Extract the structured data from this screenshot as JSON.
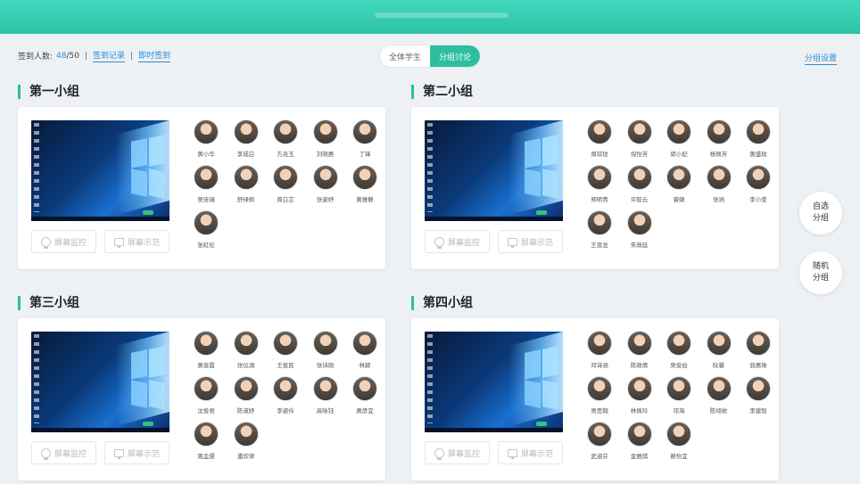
{
  "stats": {
    "label": "签到人数:",
    "checked": "48",
    "total": "/50",
    "separator": "|",
    "record_link": "签到记录",
    "instant_link": "即时签到"
  },
  "view_toggle": {
    "options": [
      "全体学生",
      "分组讨论"
    ],
    "selected": "分组讨论"
  },
  "group_settings": "分组设置",
  "side_buttons": {
    "self_select": "自选\n分组",
    "random": "随机\n分组"
  },
  "card_buttons": {
    "monitor": "屏幕监控",
    "demo": "屏幕示范"
  },
  "groups": [
    {
      "title": "第一小组",
      "members": [
        "黄小华",
        "李成白",
        "方兆玉",
        "刘晓惠",
        "丁锋",
        "吴佳瑞",
        "舒绿佩",
        "周白芷",
        "张姿妤",
        "黄雅静",
        "张虹伦"
      ]
    },
    {
      "title": "第二小组",
      "members": [
        "周琼玟",
        "倪怡芳",
        "郭小妃",
        "杨佩芳",
        "黄盛玫",
        "郑明青",
        "许智云",
        "睿婕",
        "张涵",
        "李小爱",
        "王恩龙",
        "朱政廷"
      ]
    },
    {
      "title": "第三小组",
      "members": [
        "黄竟霞",
        "张仪湖",
        "王俊民",
        "张诗刚",
        "林颖",
        "沈俊君",
        "陈淑妤",
        "李姿伶",
        "高咏钰",
        "黄彦宜",
        "周孟儒",
        "潘欣律"
      ]
    },
    {
      "title": "第四小组",
      "members": [
        "邓诗涵",
        "陈政倩",
        "吴俊伯",
        "阮馨",
        "翁惠珠",
        "吴思翰",
        "林佩玲",
        "邓海",
        "陈翊依",
        "李建智",
        "武淑芬",
        "金雅琪",
        "赖怡宜"
      ]
    }
  ],
  "colors": {
    "accent": "#2bbf9e",
    "link": "#2a8cd8",
    "header": "#3dd3b8"
  }
}
